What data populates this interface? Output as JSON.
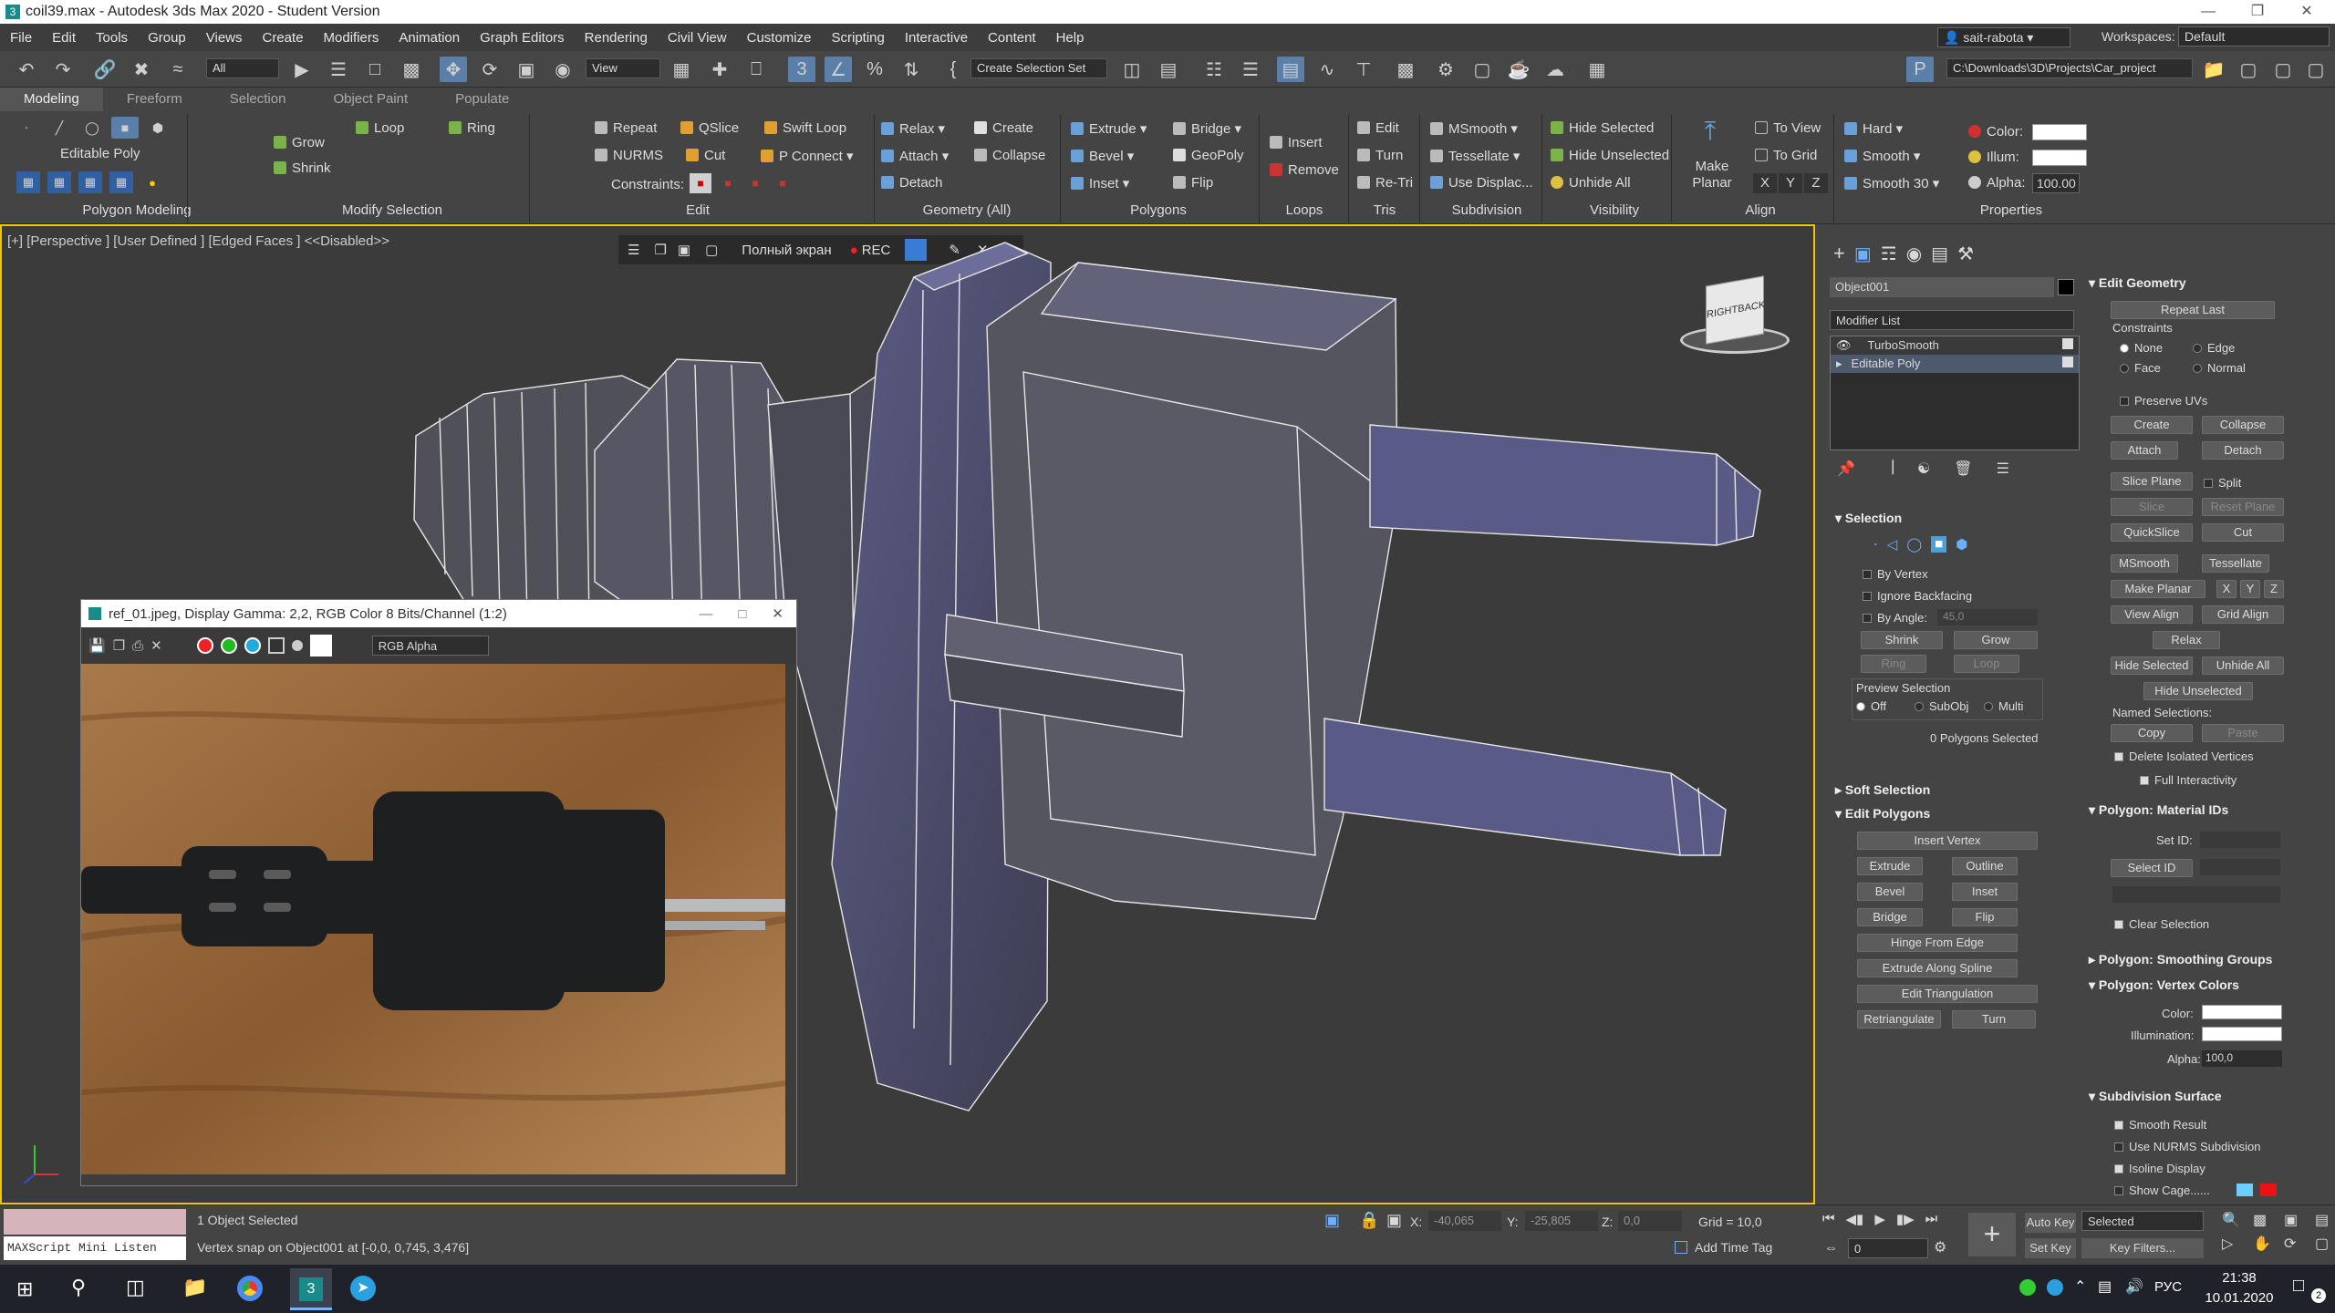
{
  "window": {
    "title": "coil39.max - Autodesk 3ds Max 2020 - Student Version"
  },
  "menu": [
    "File",
    "Edit",
    "Tools",
    "Group",
    "Views",
    "Create",
    "Modifiers",
    "Animation",
    "Graph Editors",
    "Rendering",
    "Civil View",
    "Customize",
    "Scripting",
    "Interactive",
    "Content",
    "Help"
  ],
  "user": {
    "name": "sait-rabota",
    "workspaces_label": "Workspaces:",
    "workspace": "Default"
  },
  "main_toolbar": {
    "filter": "All",
    "ref_coord": "View",
    "selection_set": "Create Selection Set",
    "project_path": "C:\\Downloads\\3D\\Projects\\Car_project"
  },
  "ribbon": {
    "tabs": [
      "Modeling",
      "Freeform",
      "Selection",
      "Object Paint",
      "Populate"
    ],
    "active_tab": "Modeling",
    "object_type": "Editable Poly",
    "groups": [
      "Polygon Modeling",
      "Modify Selection",
      "Edit",
      "Geometry (All)",
      "Polygons",
      "Loops",
      "Tris",
      "Subdivision",
      "Visibility",
      "Align",
      "Properties"
    ],
    "modify_selection": [
      "Grow",
      "Shrink",
      "Loop",
      "Ring"
    ],
    "edit": [
      "Repeat",
      "QSlice",
      "Swift Loop",
      "NURMS",
      "Cut",
      "P Connect"
    ],
    "constraints_label": "Constraints:",
    "geometry": [
      "Relax",
      "Create",
      "Attach",
      "Collapse",
      "Detach"
    ],
    "polygons": [
      "Extrude",
      "Bridge",
      "Bevel",
      "GeoPoly",
      "Inset",
      "Flip"
    ],
    "loops": [
      "Insert",
      "Remove"
    ],
    "tris": [
      "Edit",
      "Turn",
      "Re-Tri"
    ],
    "subdivision": [
      "MSmooth",
      "Tessellate",
      "Use Displac..."
    ],
    "visibility": [
      "Hide Selected",
      "Hide Unselected",
      "Unhide All"
    ],
    "align": [
      "Make Planar",
      "To View",
      "To Grid",
      "X",
      "Y",
      "Z"
    ],
    "properties": [
      "Hard",
      "Smooth",
      "Smooth 30"
    ],
    "color_label": "Color:",
    "illum_label": "Illum:",
    "alpha_label": "Alpha:",
    "alpha_value": "100.00"
  },
  "viewport": {
    "label": "[+] [Perspective ] [User Defined ] [Edged Faces ]  <<Disabled>>",
    "fullscreen": "Полный экран",
    "rec": "REC",
    "viewcube_right": "RIGHT",
    "viewcube_back": "BACK"
  },
  "ref_window": {
    "title": "ref_01.jpeg, Display Gamma: 2,2, RGB Color 8 Bits/Channel (1:2)",
    "channel": "RGB Alpha"
  },
  "command_panel": {
    "object_name": "Object001",
    "modifier_list": "Modifier List",
    "stack": [
      "TurboSmooth",
      "Editable Poly"
    ],
    "selection": {
      "title": "Selection",
      "by_vertex": "By Vertex",
      "ignore_backfacing": "Ignore Backfacing",
      "by_angle": "By Angle:",
      "angle_value": "45,0",
      "shrink": "Shrink",
      "grow": "Grow",
      "ring": "Ring",
      "loop": "Loop",
      "preview_title": "Preview Selection",
      "preview_opts": [
        "Off",
        "SubObj",
        "Multi"
      ],
      "status": "0 Polygons Selected"
    },
    "soft_selection": "Soft Selection",
    "edit_polygons": {
      "title": "Edit Polygons",
      "insert_vertex": "Insert Vertex",
      "buttons": [
        "Extrude",
        "Outline",
        "Bevel",
        "Inset",
        "Bridge",
        "Flip"
      ],
      "hinge": "Hinge From Edge",
      "extrude_spline": "Extrude Along Spline",
      "edit_tri": "Edit Triangulation",
      "retri": "Retriangulate",
      "turn": "Turn"
    },
    "edit_geometry": {
      "title": "Edit Geometry",
      "repeat_last": "Repeat Last",
      "constraints": "Constraints",
      "constraint_opts": [
        "None",
        "Edge",
        "Face",
        "Normal"
      ],
      "preserve_uvs": "Preserve UVs",
      "create": "Create",
      "collapse": "Collapse",
      "attach": "Attach",
      "detach": "Detach",
      "slice_plane": "Slice Plane",
      "split": "Split",
      "slice": "Slice",
      "reset_plane": "Reset Plane",
      "quickslice": "QuickSlice",
      "cut": "Cut",
      "msmooth": "MSmooth",
      "tessellate": "Tessellate",
      "make_planar": "Make Planar",
      "x": "X",
      "y": "Y",
      "z": "Z",
      "view_align": "View Align",
      "grid_align": "Grid Align",
      "relax": "Relax",
      "hide_selected": "Hide Selected",
      "unhide_all": "Unhide All",
      "hide_unselected": "Hide Unselected",
      "named_selections": "Named Selections:",
      "copy": "Copy",
      "paste": "Paste",
      "delete_isolated": "Delete Isolated Vertices",
      "full_interactivity": "Full Interactivity"
    },
    "material_ids": {
      "title": "Polygon: Material IDs",
      "set_id": "Set ID:",
      "select_id": "Select ID",
      "clear_selection": "Clear Selection"
    },
    "smoothing_groups": "Polygon: Smoothing Groups",
    "vertex_colors": {
      "title": "Polygon: Vertex Colors",
      "color": "Color:",
      "illumination": "Illumination:",
      "alpha": "Alpha:",
      "alpha_value": "100,0"
    },
    "subdivision": {
      "title": "Subdivision Surface",
      "smooth_result": "Smooth Result",
      "use_nurms": "Use NURMS Subdivision",
      "isoline": "Isoline Display",
      "show_cage": "Show Cage......"
    }
  },
  "status_bar": {
    "maxscript": "MAXScript Mini Listen",
    "selected": "1 Object Selected",
    "prompt": "Vertex snap on Object001 at [-0,0, 0,745, 3,476]",
    "x_label": "X:",
    "x": "-40,065",
    "y_label": "Y:",
    "y": "-25,805",
    "z_label": "Z:",
    "z": "0,0",
    "grid": "Grid = 10,0",
    "add_time_tag": "Add Time Tag",
    "auto_key": "Auto Key",
    "set_key": "Set Key",
    "key_mode": "Selected",
    "key_filters": "Key Filters...",
    "frame": "0"
  },
  "taskbar": {
    "lang": "РУС",
    "time": "21:38",
    "date": "10.01.2020",
    "notif": "2"
  }
}
